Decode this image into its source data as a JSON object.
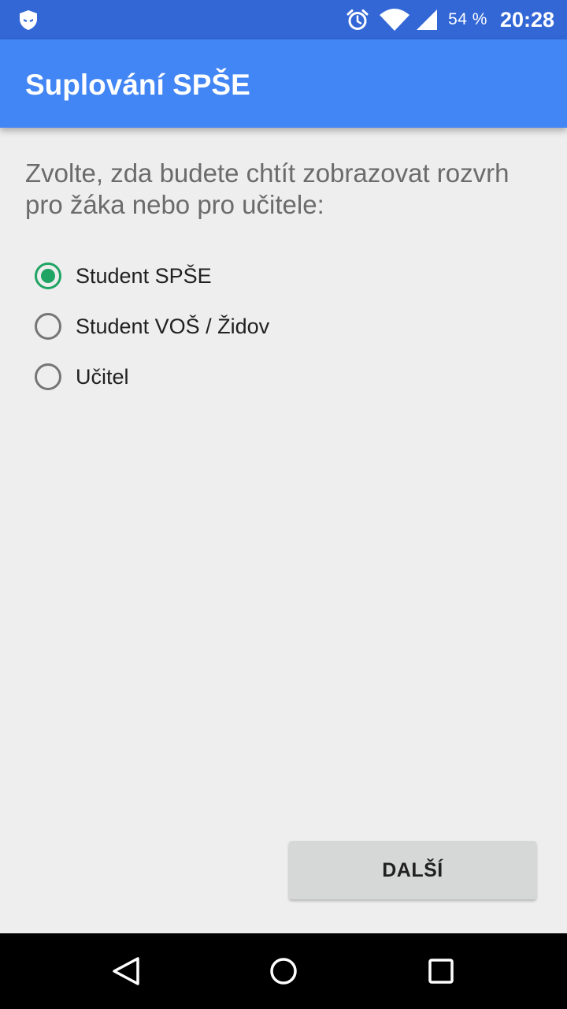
{
  "status_bar": {
    "notification_icon": "shield-icon",
    "icons": [
      "alarm-icon",
      "wifi-icon",
      "cell-signal-icon"
    ],
    "battery": "54 %",
    "time": "20:28"
  },
  "app_bar": {
    "title": "Suplování SPŠE"
  },
  "prompt": "Zvolte, zda budete chtít zobrazovat rozvrh pro žáka nebo pro učitele:",
  "options": [
    {
      "label": "Student SPŠE",
      "checked": true
    },
    {
      "label": "Student VOŠ / Židov",
      "checked": false
    },
    {
      "label": "Učitel",
      "checked": false
    }
  ],
  "next_button": {
    "label": "DALŠÍ"
  },
  "nav_bar": {
    "buttons": [
      "back-icon",
      "home-icon",
      "recents-icon"
    ]
  },
  "colors": {
    "status_bar": "#3367d6",
    "app_bar": "#4285f4",
    "accent": "#1fa463",
    "background": "#eeeeee",
    "button": "#d6d7d7"
  }
}
